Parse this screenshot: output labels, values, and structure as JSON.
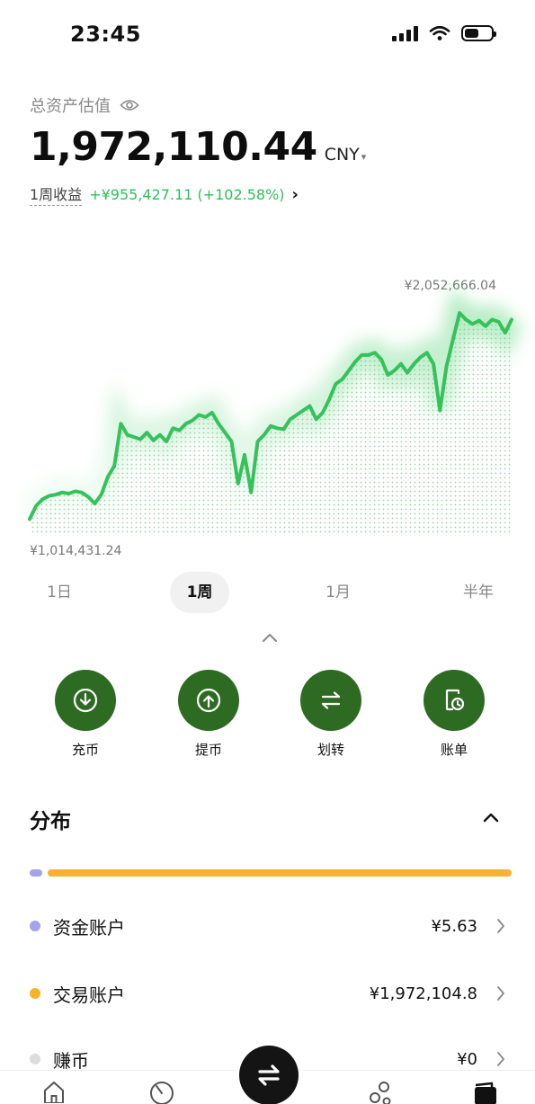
{
  "status_bar": {
    "time": "23:45",
    "battery_level": 0.55
  },
  "asset": {
    "label": "总资产估值",
    "amount": "1,972,110.44",
    "currency": "CNY",
    "period_label": "1周收益",
    "period_gain": "+¥955,427.11 (+102.58%)"
  },
  "chart_data": {
    "type": "area",
    "max_label": "¥2,052,666.04",
    "min_label": "¥1,014,431.24",
    "ylim": [
      1014431.24,
      2052666.04
    ],
    "values": [
      1090000,
      1150000,
      1180000,
      1195000,
      1200000,
      1210000,
      1205000,
      1215000,
      1210000,
      1190000,
      1160000,
      1200000,
      1280000,
      1330000,
      1520000,
      1470000,
      1460000,
      1450000,
      1480000,
      1445000,
      1470000,
      1440000,
      1500000,
      1490000,
      1520000,
      1535000,
      1560000,
      1550000,
      1570000,
      1520000,
      1480000,
      1440000,
      1250000,
      1380000,
      1210000,
      1440000,
      1470000,
      1510000,
      1500000,
      1495000,
      1540000,
      1560000,
      1580000,
      1600000,
      1540000,
      1570000,
      1630000,
      1700000,
      1720000,
      1760000,
      1800000,
      1830000,
      1830000,
      1840000,
      1810000,
      1740000,
      1760000,
      1790000,
      1750000,
      1790000,
      1820000,
      1840000,
      1790000,
      1580000,
      1780000,
      1900000,
      2020000,
      1990000,
      1970000,
      1985000,
      1960000,
      1990000,
      1980000,
      1930000,
      1990000
    ],
    "color": "#35c25a"
  },
  "range_tabs": [
    "1日",
    "1周",
    "1月",
    "半年"
  ],
  "active_range": "1周",
  "actions": [
    {
      "label": "充币",
      "icon": "deposit-icon"
    },
    {
      "label": "提币",
      "icon": "withdraw-icon"
    },
    {
      "label": "划转",
      "icon": "transfer-icon"
    },
    {
      "label": "账单",
      "icon": "bill-icon"
    }
  ],
  "distribution": {
    "title": "分布",
    "accounts": [
      {
        "name": "资金账户",
        "amount": "¥5.63",
        "color": "#a3a3ee"
      },
      {
        "name": "交易账户",
        "amount": "¥1,972,104.8",
        "color": "#f7b32b"
      },
      {
        "name": "赚币",
        "amount": "¥0",
        "color": "#dcdcdc"
      }
    ]
  },
  "bottom_nav": [
    "home-icon",
    "markets-icon",
    "trade-icon",
    "discover-icon",
    "assets-icon"
  ],
  "colors": {
    "accent": "#2e6b22",
    "gain": "#2fbf59",
    "funding": "#a3a3ee",
    "trading": "#f7b32b"
  }
}
